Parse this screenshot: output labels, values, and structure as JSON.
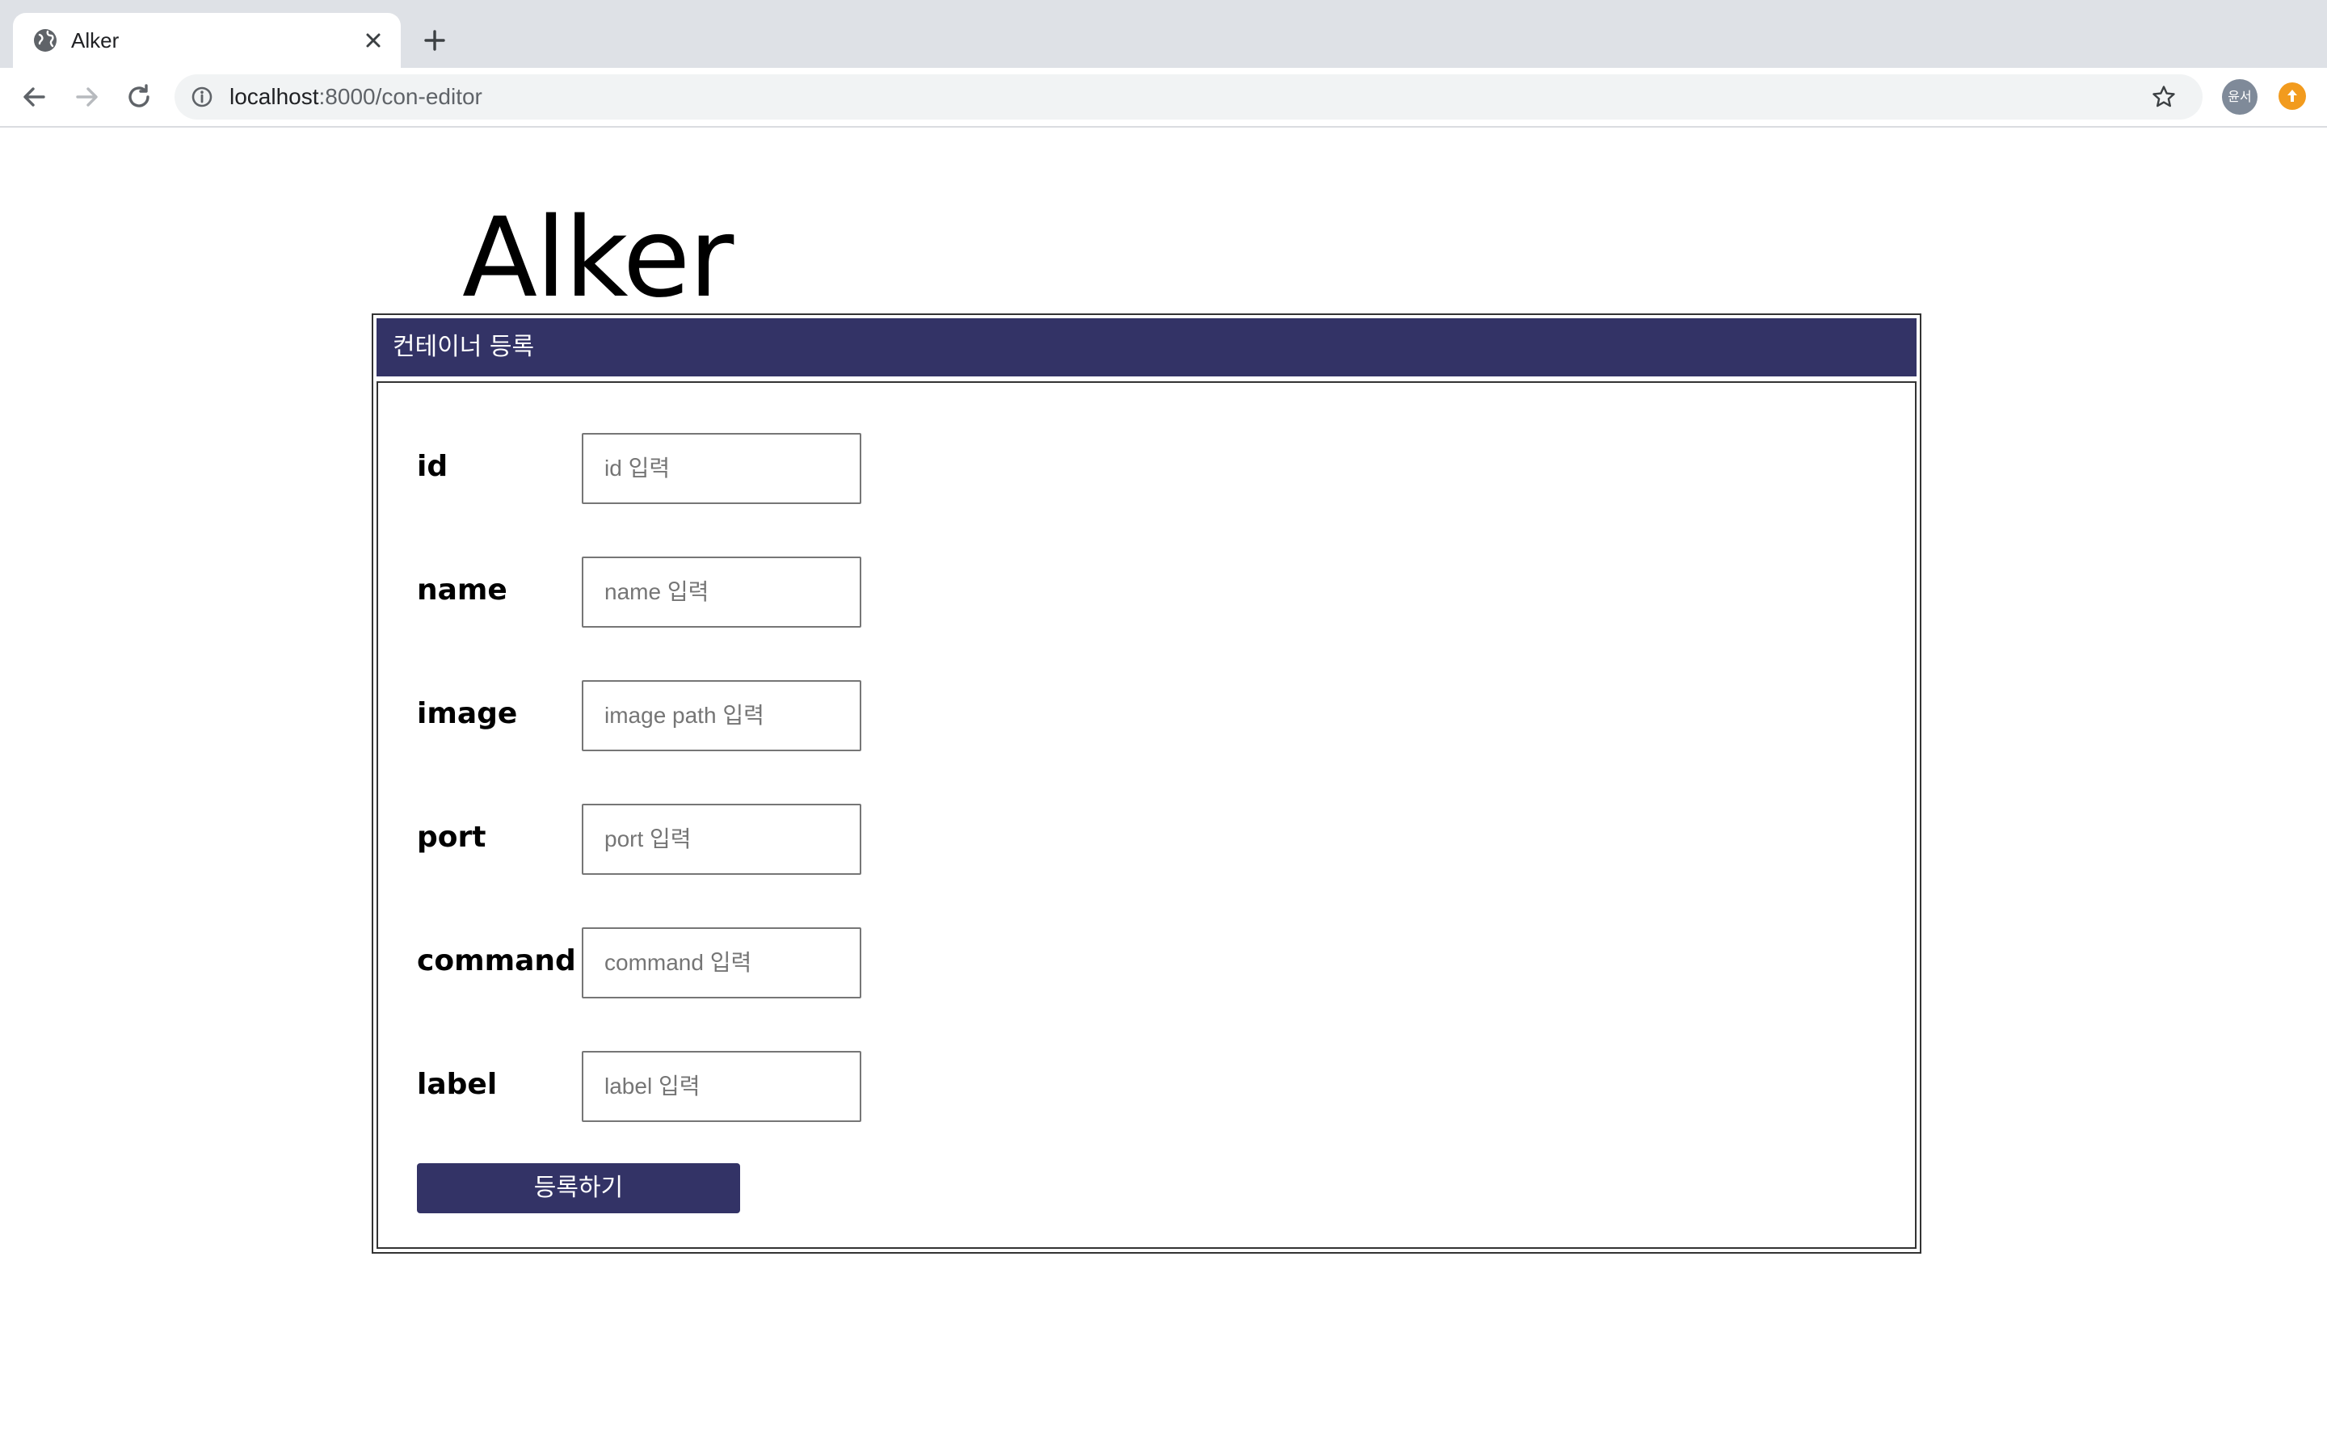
{
  "browser": {
    "tab_title": "Alker",
    "url_host": "localhost",
    "url_path": ":8000/con-editor",
    "profile_label": "윤서",
    "icons": {
      "tab": "globe-icon",
      "close": "close-icon",
      "new_tab": "plus-icon",
      "back": "arrow-left-icon",
      "forward": "arrow-right-icon",
      "reload": "reload-icon",
      "site_info": "info-icon",
      "bookmark": "star-icon",
      "extension": "extension-icon"
    }
  },
  "page": {
    "title": "Alker",
    "panel_title": "컨테이너 등록",
    "fields": [
      {
        "label": "id",
        "placeholder": "id 입력",
        "value": ""
      },
      {
        "label": "name",
        "placeholder": "name 입력",
        "value": ""
      },
      {
        "label": "image",
        "placeholder": "image path 입력",
        "value": ""
      },
      {
        "label": "port",
        "placeholder": "port 입력",
        "value": ""
      },
      {
        "label": "command",
        "placeholder": "command 입력",
        "value": ""
      },
      {
        "label": "label",
        "placeholder": "label 입력",
        "value": ""
      }
    ],
    "submit_label": "등록하기"
  },
  "colors": {
    "accent": "#333366",
    "tabbar": "#dee1e6",
    "omnibox": "#f1f3f4",
    "extension": "#f29b1e"
  }
}
